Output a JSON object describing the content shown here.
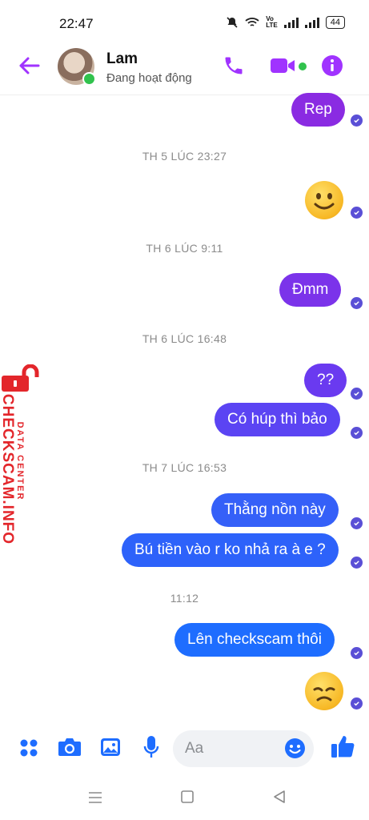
{
  "status_bar": {
    "time": "22:47",
    "battery": "44"
  },
  "header": {
    "contact_name": "Lam",
    "contact_status": "Đang hoạt động"
  },
  "messages": [
    {
      "type": "text",
      "text": "Rep"
    },
    {
      "type": "timestamp",
      "text": "TH 5 LÚC 23:27"
    },
    {
      "type": "emoji",
      "emoji": "smile"
    },
    {
      "type": "timestamp",
      "text": "TH 6 LÚC 9:11"
    },
    {
      "type": "text",
      "text": "Đmm"
    },
    {
      "type": "timestamp",
      "text": "TH 6 LÚC 16:48"
    },
    {
      "type": "text",
      "text": "??"
    },
    {
      "type": "text",
      "text": "Có húp thì bảo"
    },
    {
      "type": "timestamp",
      "text": "TH 7 LÚC 16:53"
    },
    {
      "type": "text",
      "text": "Thằng nồn này"
    },
    {
      "type": "text",
      "text": "Bú tiền vào r ko nhả ra à e ?"
    },
    {
      "type": "timestamp",
      "text": "11:12"
    },
    {
      "type": "text",
      "text": "Lên checkscam thôi"
    },
    {
      "type": "emoji",
      "emoji": "disappointed"
    }
  ],
  "composer": {
    "placeholder": "Aa"
  },
  "watermark": {
    "line1": "DATA CENTER",
    "line2": "CHECKSCAM.INFO"
  },
  "colors": {
    "accent": "#a033ff",
    "bubble_purple": "#8a2be2",
    "bubble_blue": "#1e6dff",
    "online": "#31c24d"
  }
}
